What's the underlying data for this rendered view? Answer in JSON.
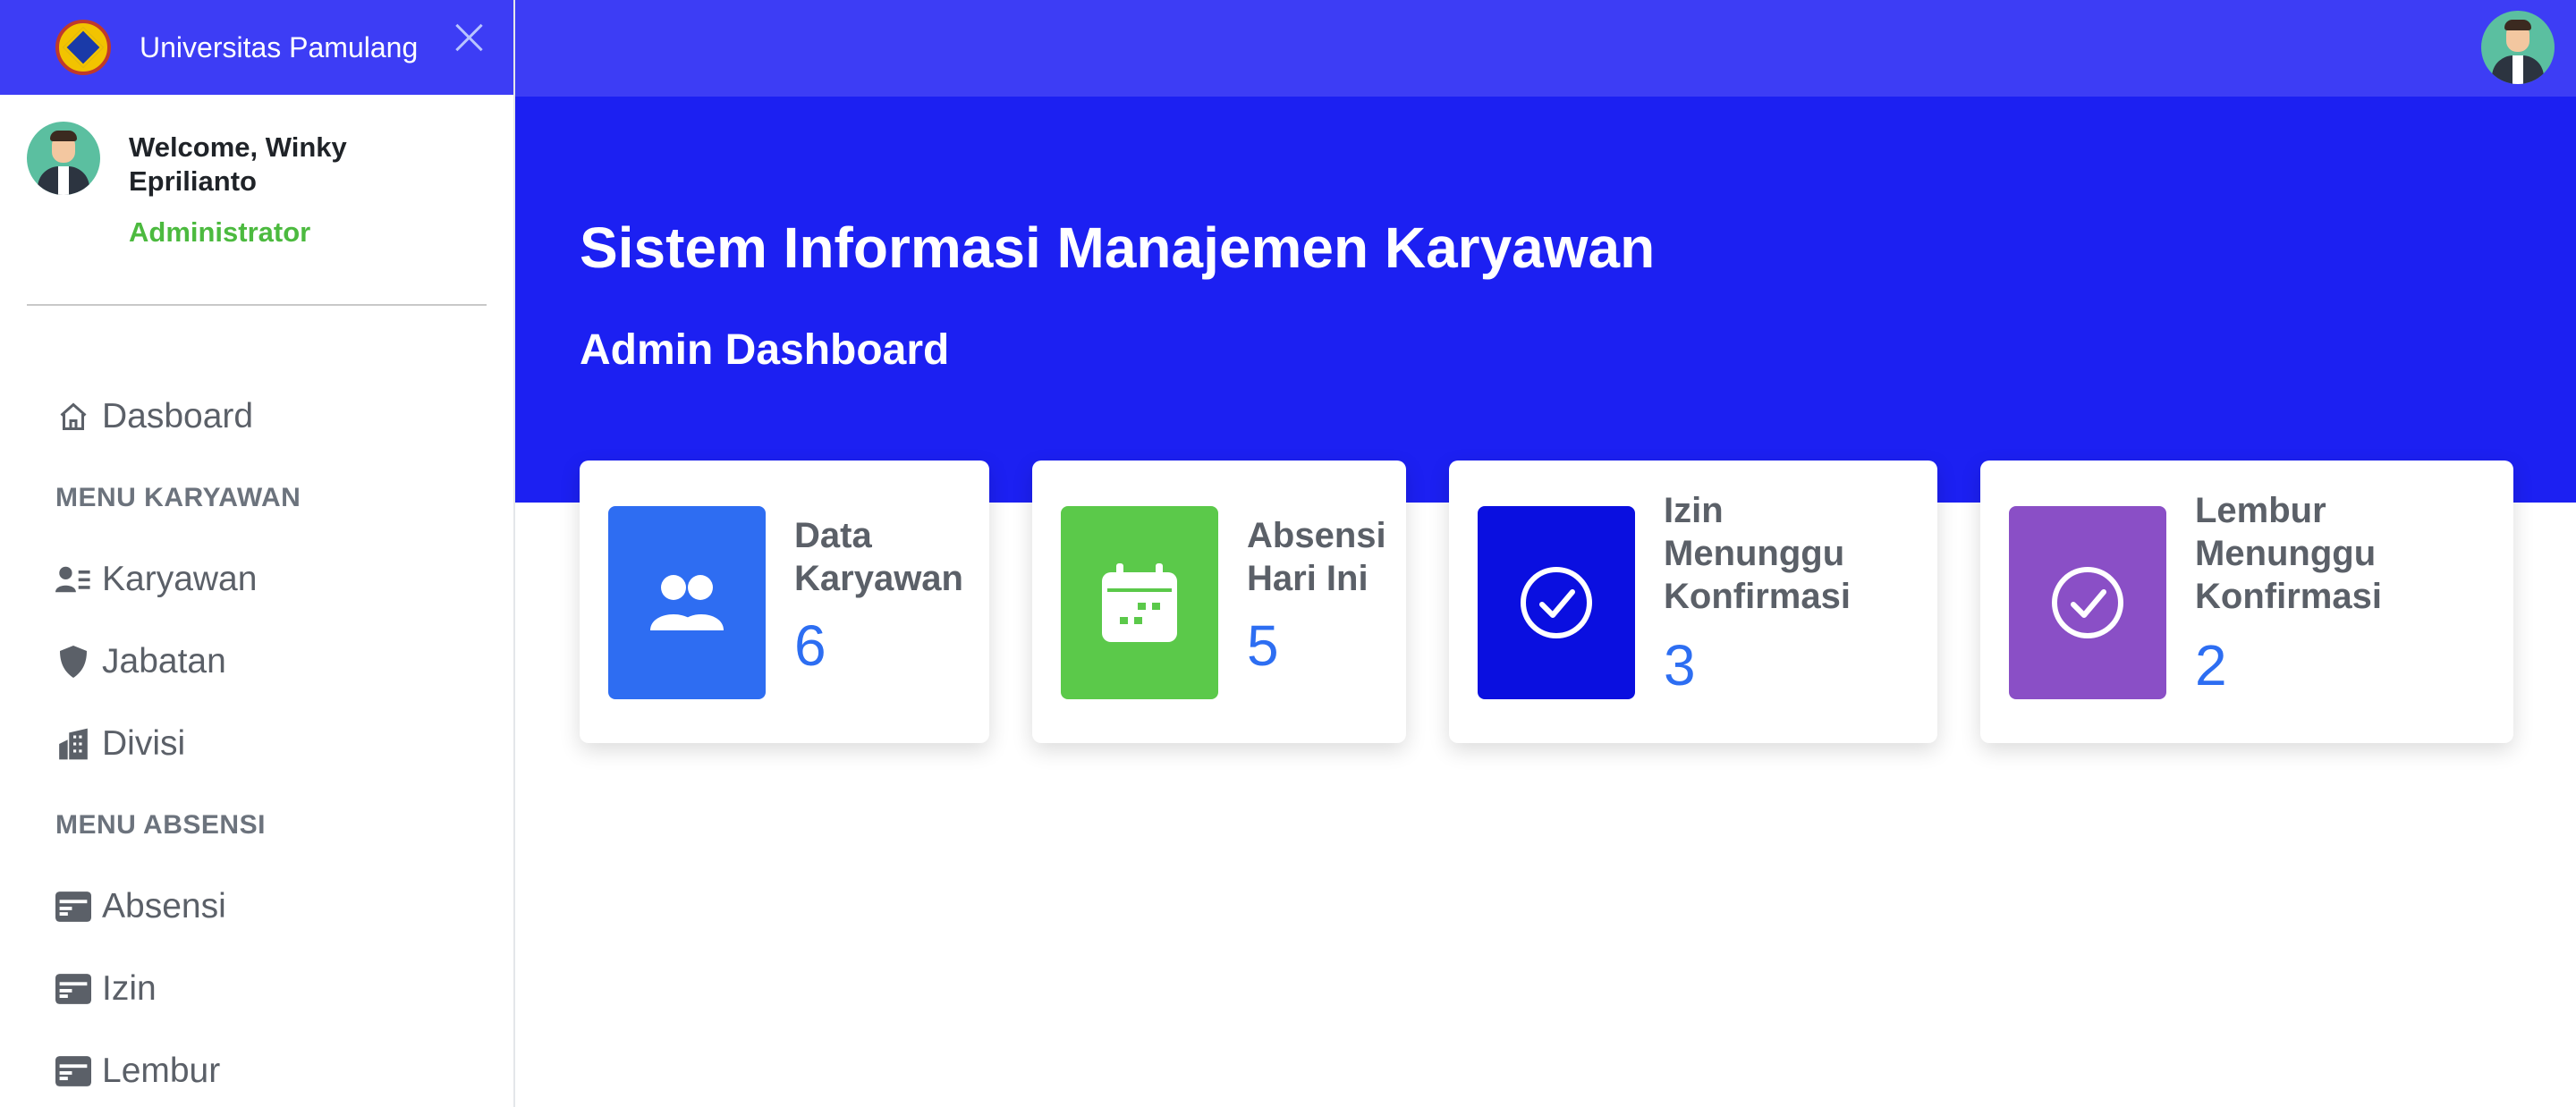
{
  "sidebar": {
    "brand_name": "Universitas Pamulang",
    "welcome": "Welcome, Winky Eprilianto",
    "role": "Administrator",
    "menu": {
      "dashboard": "Dasboard",
      "section_karyawan": "MENU KARYAWAN",
      "karyawan": "Karyawan",
      "jabatan": "Jabatan",
      "divisi": "Divisi",
      "section_absensi": "MENU ABSENSI",
      "absensi": "Absensi",
      "izin": "Izin",
      "lembur": "Lembur"
    }
  },
  "hero": {
    "title": "Sistem Informasi Manajemen Karyawan",
    "subtitle": "Admin Dashboard"
  },
  "cards": [
    {
      "label": "Data Karyawan",
      "value": "6",
      "icon": "users-icon",
      "color": "#2e6df2"
    },
    {
      "label": "Absensi Hari Ini",
      "value": "5",
      "icon": "calendar-icon",
      "color": "#5bc94a"
    },
    {
      "label": "Izin Menunggu Konfirmasi",
      "value": "3",
      "icon": "check-circle-icon",
      "color": "#0a0fe0"
    },
    {
      "label": "Lembur Menunggu Konfirmasi",
      "value": "2",
      "icon": "check-circle-icon",
      "color": "#8a4fc6"
    }
  ],
  "colors": {
    "topbar": "#3d3df5",
    "hero": "#1c20f2",
    "accent_green": "#4cba3f",
    "value_blue": "#2d6ef2"
  }
}
